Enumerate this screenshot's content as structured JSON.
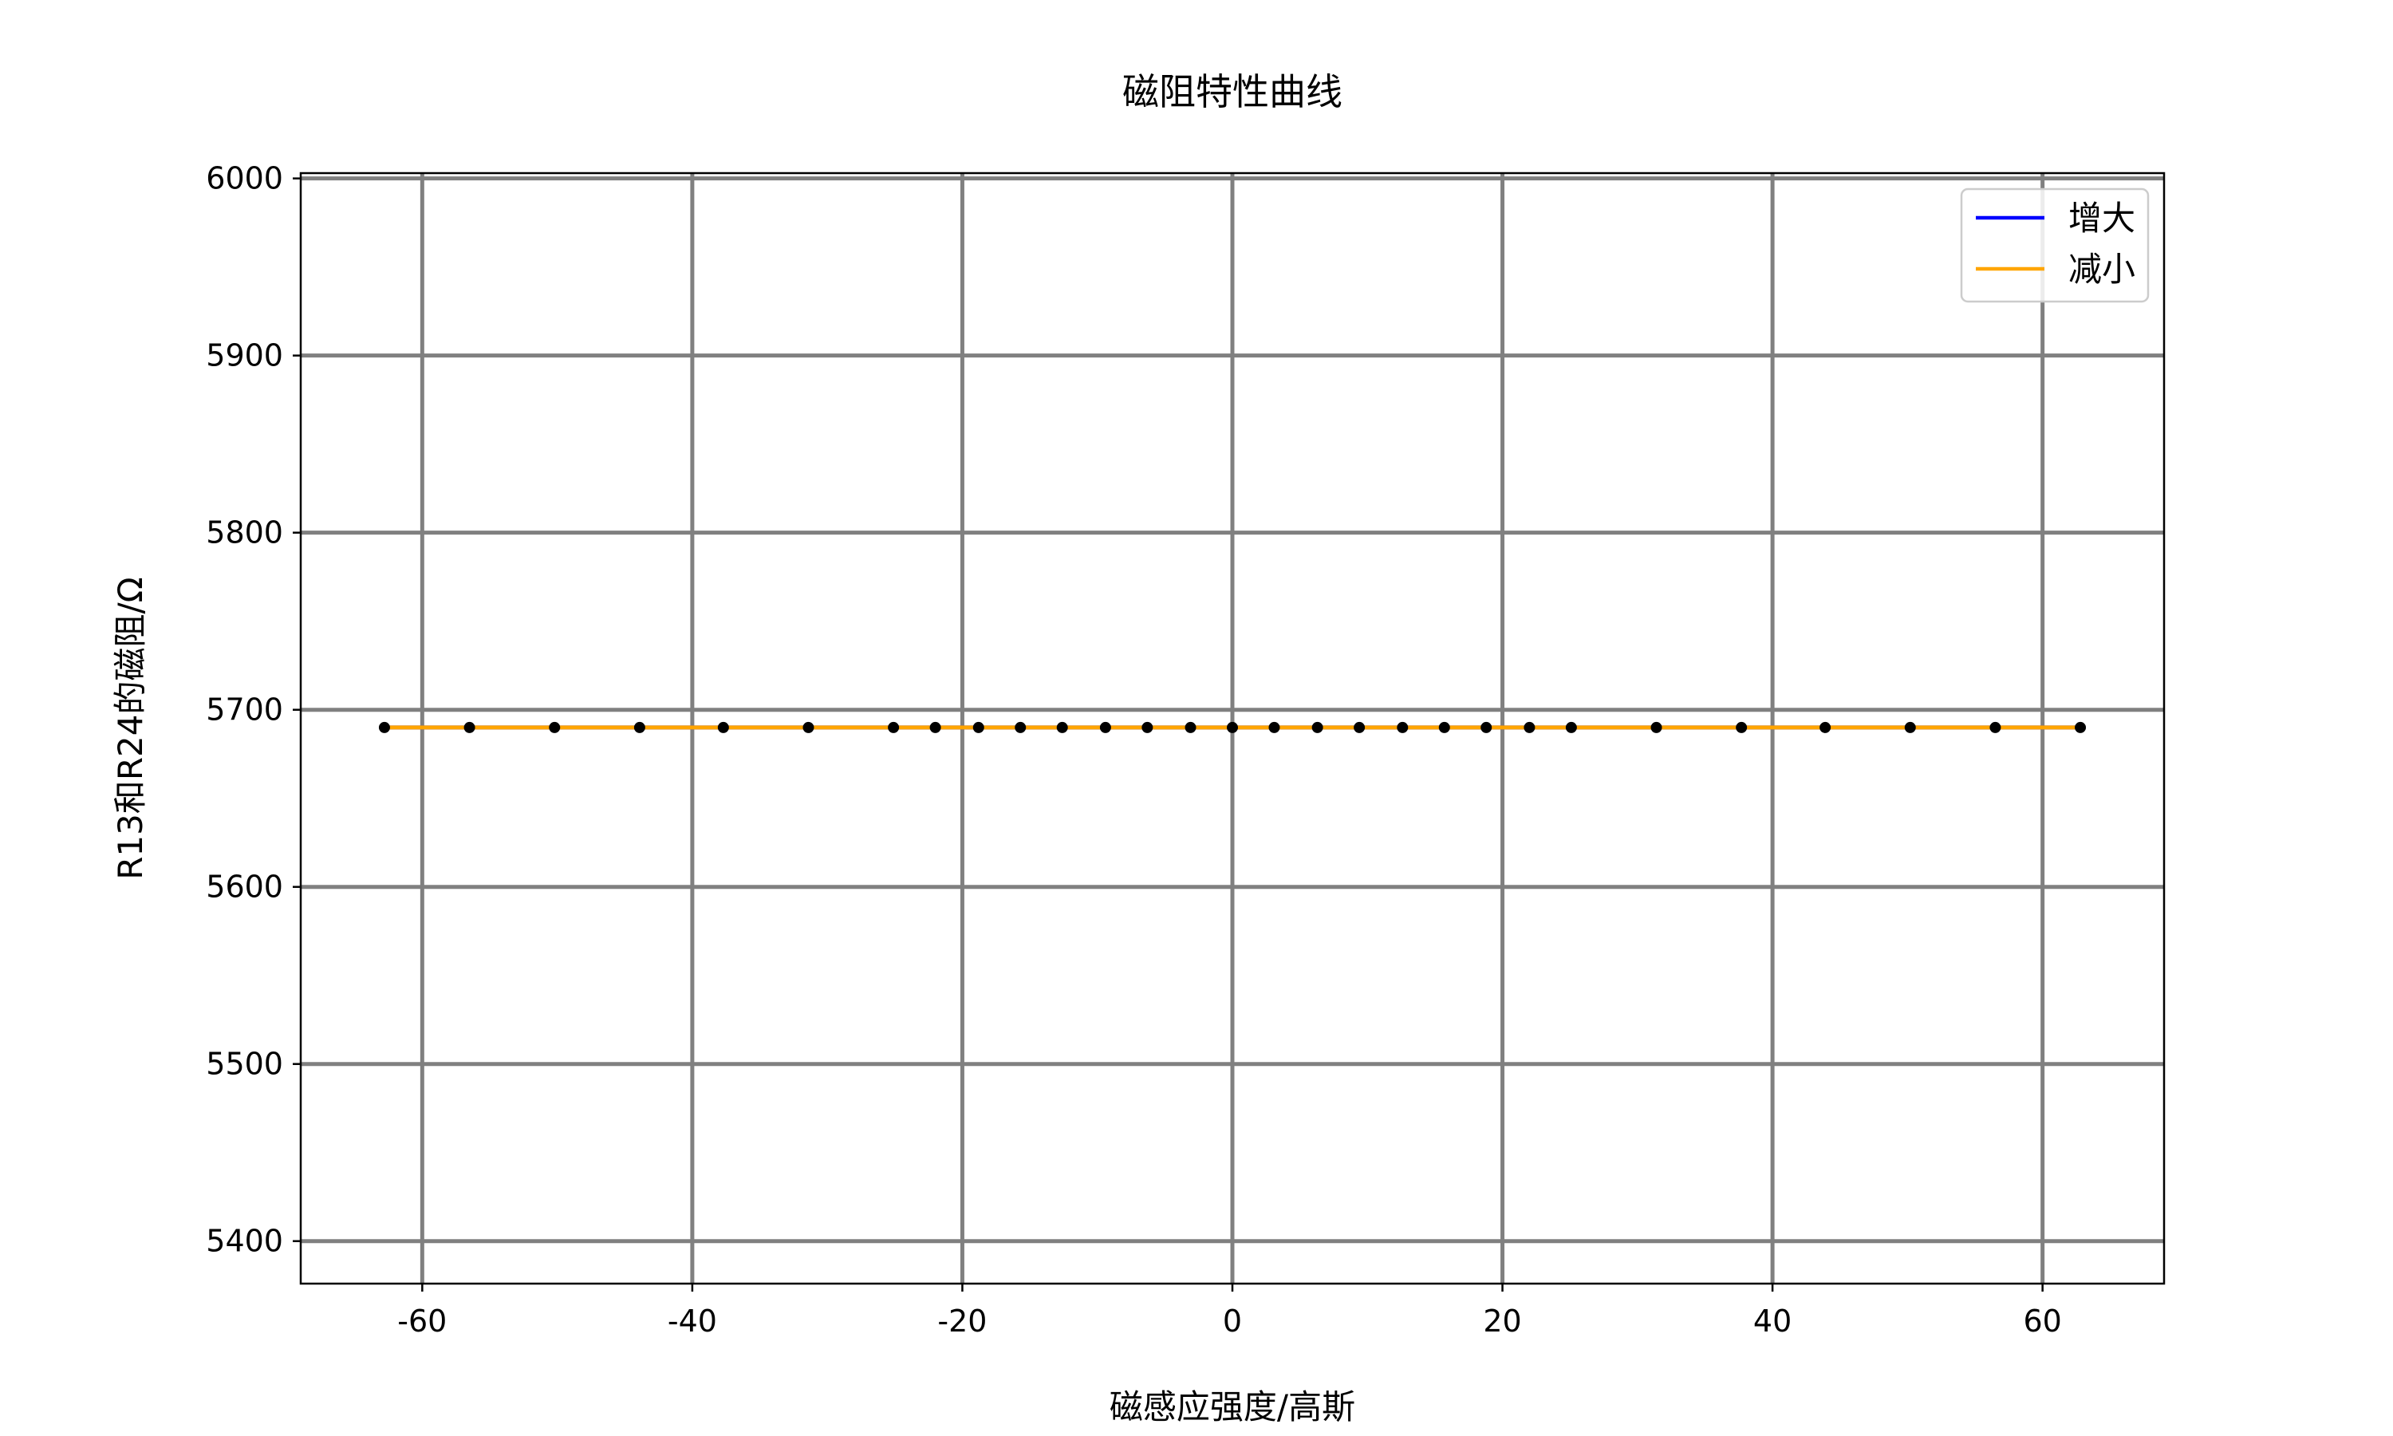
{
  "chart_data": {
    "type": "line",
    "title": "磁阻特性曲线",
    "xlabel": "磁感应强度/高斯",
    "ylabel": "R13和R24的磁阻/Ω",
    "xlim": [
      -69,
      69
    ],
    "ylim": [
      5376,
      6003
    ],
    "xticks": [
      -60,
      -40,
      -20,
      0,
      20,
      40,
      60
    ],
    "xtick_labels": [
      "-60",
      "-40",
      "-20",
      "0",
      "20",
      "40",
      "60"
    ],
    "yticks": [
      5400,
      5500,
      5600,
      5700,
      5800,
      5900,
      6000
    ],
    "ytick_labels": [
      "5400",
      "5500",
      "5600",
      "5700",
      "5800",
      "5900",
      "6000"
    ],
    "grid": true,
    "legend_position": "top-right",
    "x": [
      -62.8,
      -56.5,
      -50.2,
      -43.9,
      -37.7,
      -31.4,
      -25.1,
      -22.0,
      -18.8,
      -15.7,
      -12.6,
      -9.4,
      -6.3,
      -3.1,
      0,
      3.1,
      6.3,
      9.4,
      12.6,
      15.7,
      18.8,
      22.0,
      25.1,
      31.4,
      37.7,
      43.9,
      50.2,
      56.5,
      62.8
    ],
    "series": [
      {
        "name": "增大",
        "color": "#0000ff",
        "values": [
          5690,
          5690,
          5690,
          5690,
          5690,
          5690,
          5690,
          5690,
          5690,
          5690,
          5690,
          5690,
          5690,
          5690,
          5690,
          5690,
          5690,
          5690,
          5690,
          5690,
          5690,
          5690,
          5690,
          5690,
          5690,
          5690,
          5690,
          5690,
          5690
        ]
      },
      {
        "name": "减小",
        "color": "#ffa500",
        "values": [
          5690,
          5690,
          5690,
          5690,
          5690,
          5690,
          5690,
          5690,
          5690,
          5690,
          5690,
          5690,
          5690,
          5690,
          5690,
          5690,
          5690,
          5690,
          5690,
          5690,
          5690,
          5690,
          5690,
          5690,
          5690,
          5690,
          5690,
          5690,
          5690
        ]
      }
    ],
    "marker_color": "#000000",
    "grid_color": "#808080"
  }
}
